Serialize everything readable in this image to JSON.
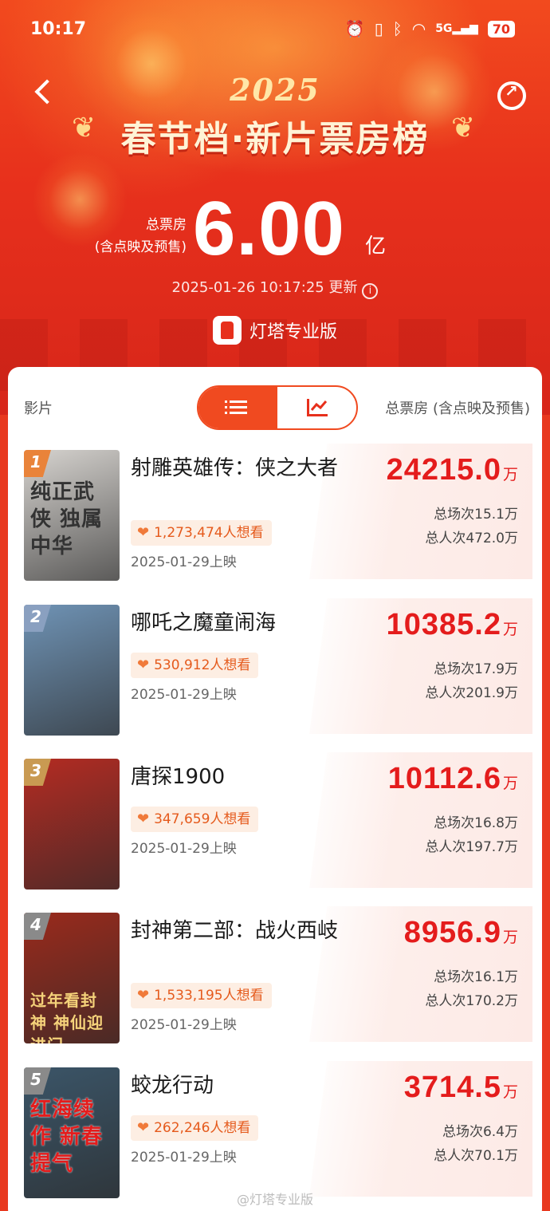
{
  "status_bar": {
    "time": "10:17",
    "signal": "5G",
    "battery": "70"
  },
  "header": {
    "year": "2025",
    "title": "春节档·新片票房榜"
  },
  "total": {
    "label_line1": "总票房",
    "label_line2": "(含点映及预售)",
    "value": "6.00",
    "unit": "亿",
    "updated": "2025-01-26 10:17:25 更新"
  },
  "brand": {
    "name": "灯塔专业版"
  },
  "table": {
    "col_film": "影片",
    "col_total": "总票房 (含点映及预售)",
    "view_toggle": {
      "list_icon": "list-icon",
      "chart_icon": "trend-chart-icon",
      "active": "list"
    }
  },
  "films": [
    {
      "rank": "1",
      "poster_text": "纯正武侠 独属中华",
      "name": "射雕英雄传：侠之大者",
      "want": "1,273,474人想看",
      "release": "2025-01-29上映",
      "gross": "24215.0",
      "gross_unit": "万",
      "shows": "总场次15.1万",
      "viewers": "总人次472.0万",
      "rank_color": "#e9833a",
      "poster_color": "#d6d3cf"
    },
    {
      "rank": "2",
      "poster_text": "",
      "name": "哪吒之魔童闹海",
      "want": "530,912人想看",
      "release": "2025-01-29上映",
      "gross": "10385.2",
      "gross_unit": "万",
      "shows": "总场次17.9万",
      "viewers": "总人次201.9万",
      "rank_color": "#8aa0c0",
      "poster_color": "#6f93b5"
    },
    {
      "rank": "3",
      "poster_text": "",
      "name": "唐探1900",
      "want": "347,659人想看",
      "release": "2025-01-29上映",
      "gross": "10112.6",
      "gross_unit": "万",
      "shows": "总场次16.8万",
      "viewers": "总人次197.7万",
      "rank_color": "#c99a52",
      "poster_color": "#b42b22"
    },
    {
      "rank": "4",
      "poster_text": "过年看封神 神仙迎进门",
      "name": "封神第二部：战火西岐",
      "want": "1,533,195人想看",
      "release": "2025-01-29上映",
      "gross": "8956.9",
      "gross_unit": "万",
      "shows": "总场次16.1万",
      "viewers": "总人次170.2万",
      "rank_color": "#8a8a8a",
      "poster_color": "#9a2a1c"
    },
    {
      "rank": "5",
      "poster_text": "红海续作 新春提气",
      "name": "蛟龙行动",
      "want": "262,246人想看",
      "release": "2025-01-29上映",
      "gross": "3714.5",
      "gross_unit": "万",
      "shows": "总场次6.4万",
      "viewers": "总人次70.1万",
      "rank_color": "#8a8a8a",
      "poster_color": "#3b5568"
    }
  ],
  "watermark": "@灯塔专业版"
}
